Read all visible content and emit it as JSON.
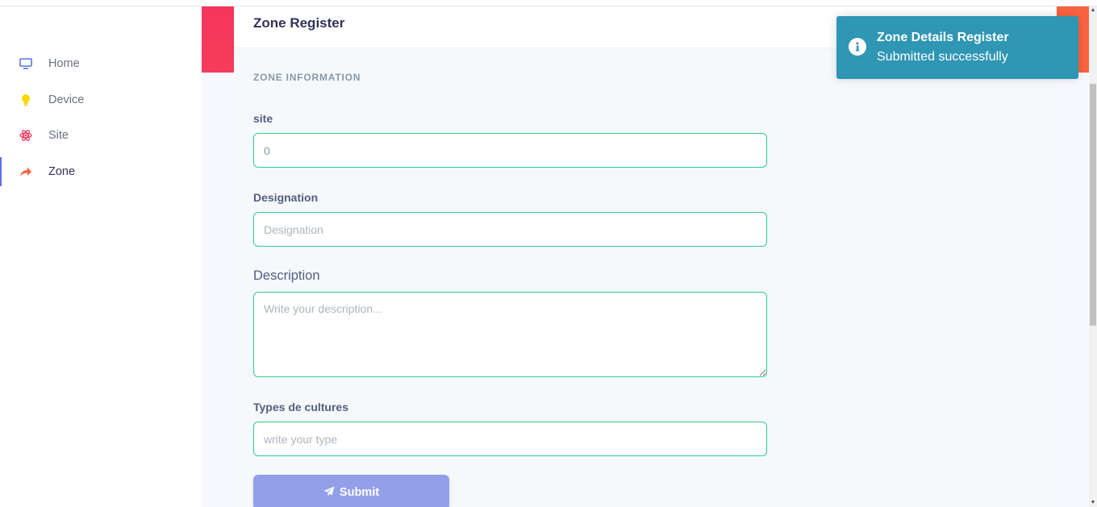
{
  "sidebar": {
    "items": [
      {
        "label": "Home",
        "icon": "monitor-icon",
        "color": "#5e72e4"
      },
      {
        "label": "Device",
        "icon": "lightbulb-icon",
        "color": "#ffd600"
      },
      {
        "label": "Site",
        "icon": "atom-icon",
        "color": "#f5365c"
      },
      {
        "label": "Zone",
        "icon": "share-arrow-icon",
        "color": "#fb6340",
        "active": true
      }
    ]
  },
  "card": {
    "title": "Zone Register",
    "section": "ZONE INFORMATION"
  },
  "form": {
    "site": {
      "label": "site",
      "value": "0"
    },
    "designation": {
      "label": "Designation",
      "placeholder": "Designation"
    },
    "description": {
      "label": "Description",
      "placeholder": "Write your description..."
    },
    "types": {
      "label": "Types de cultures",
      "placeholder": "write your type"
    },
    "submit_label": "Submit"
  },
  "toast": {
    "title": "Zone Details Register",
    "message": "Submitted successfully",
    "icon": "info-icon"
  },
  "colors": {
    "accent": "#5e72e4",
    "success_border": "#2dce89",
    "toast_bg": "#2f96b4",
    "submit_bg": "#949fe9"
  }
}
